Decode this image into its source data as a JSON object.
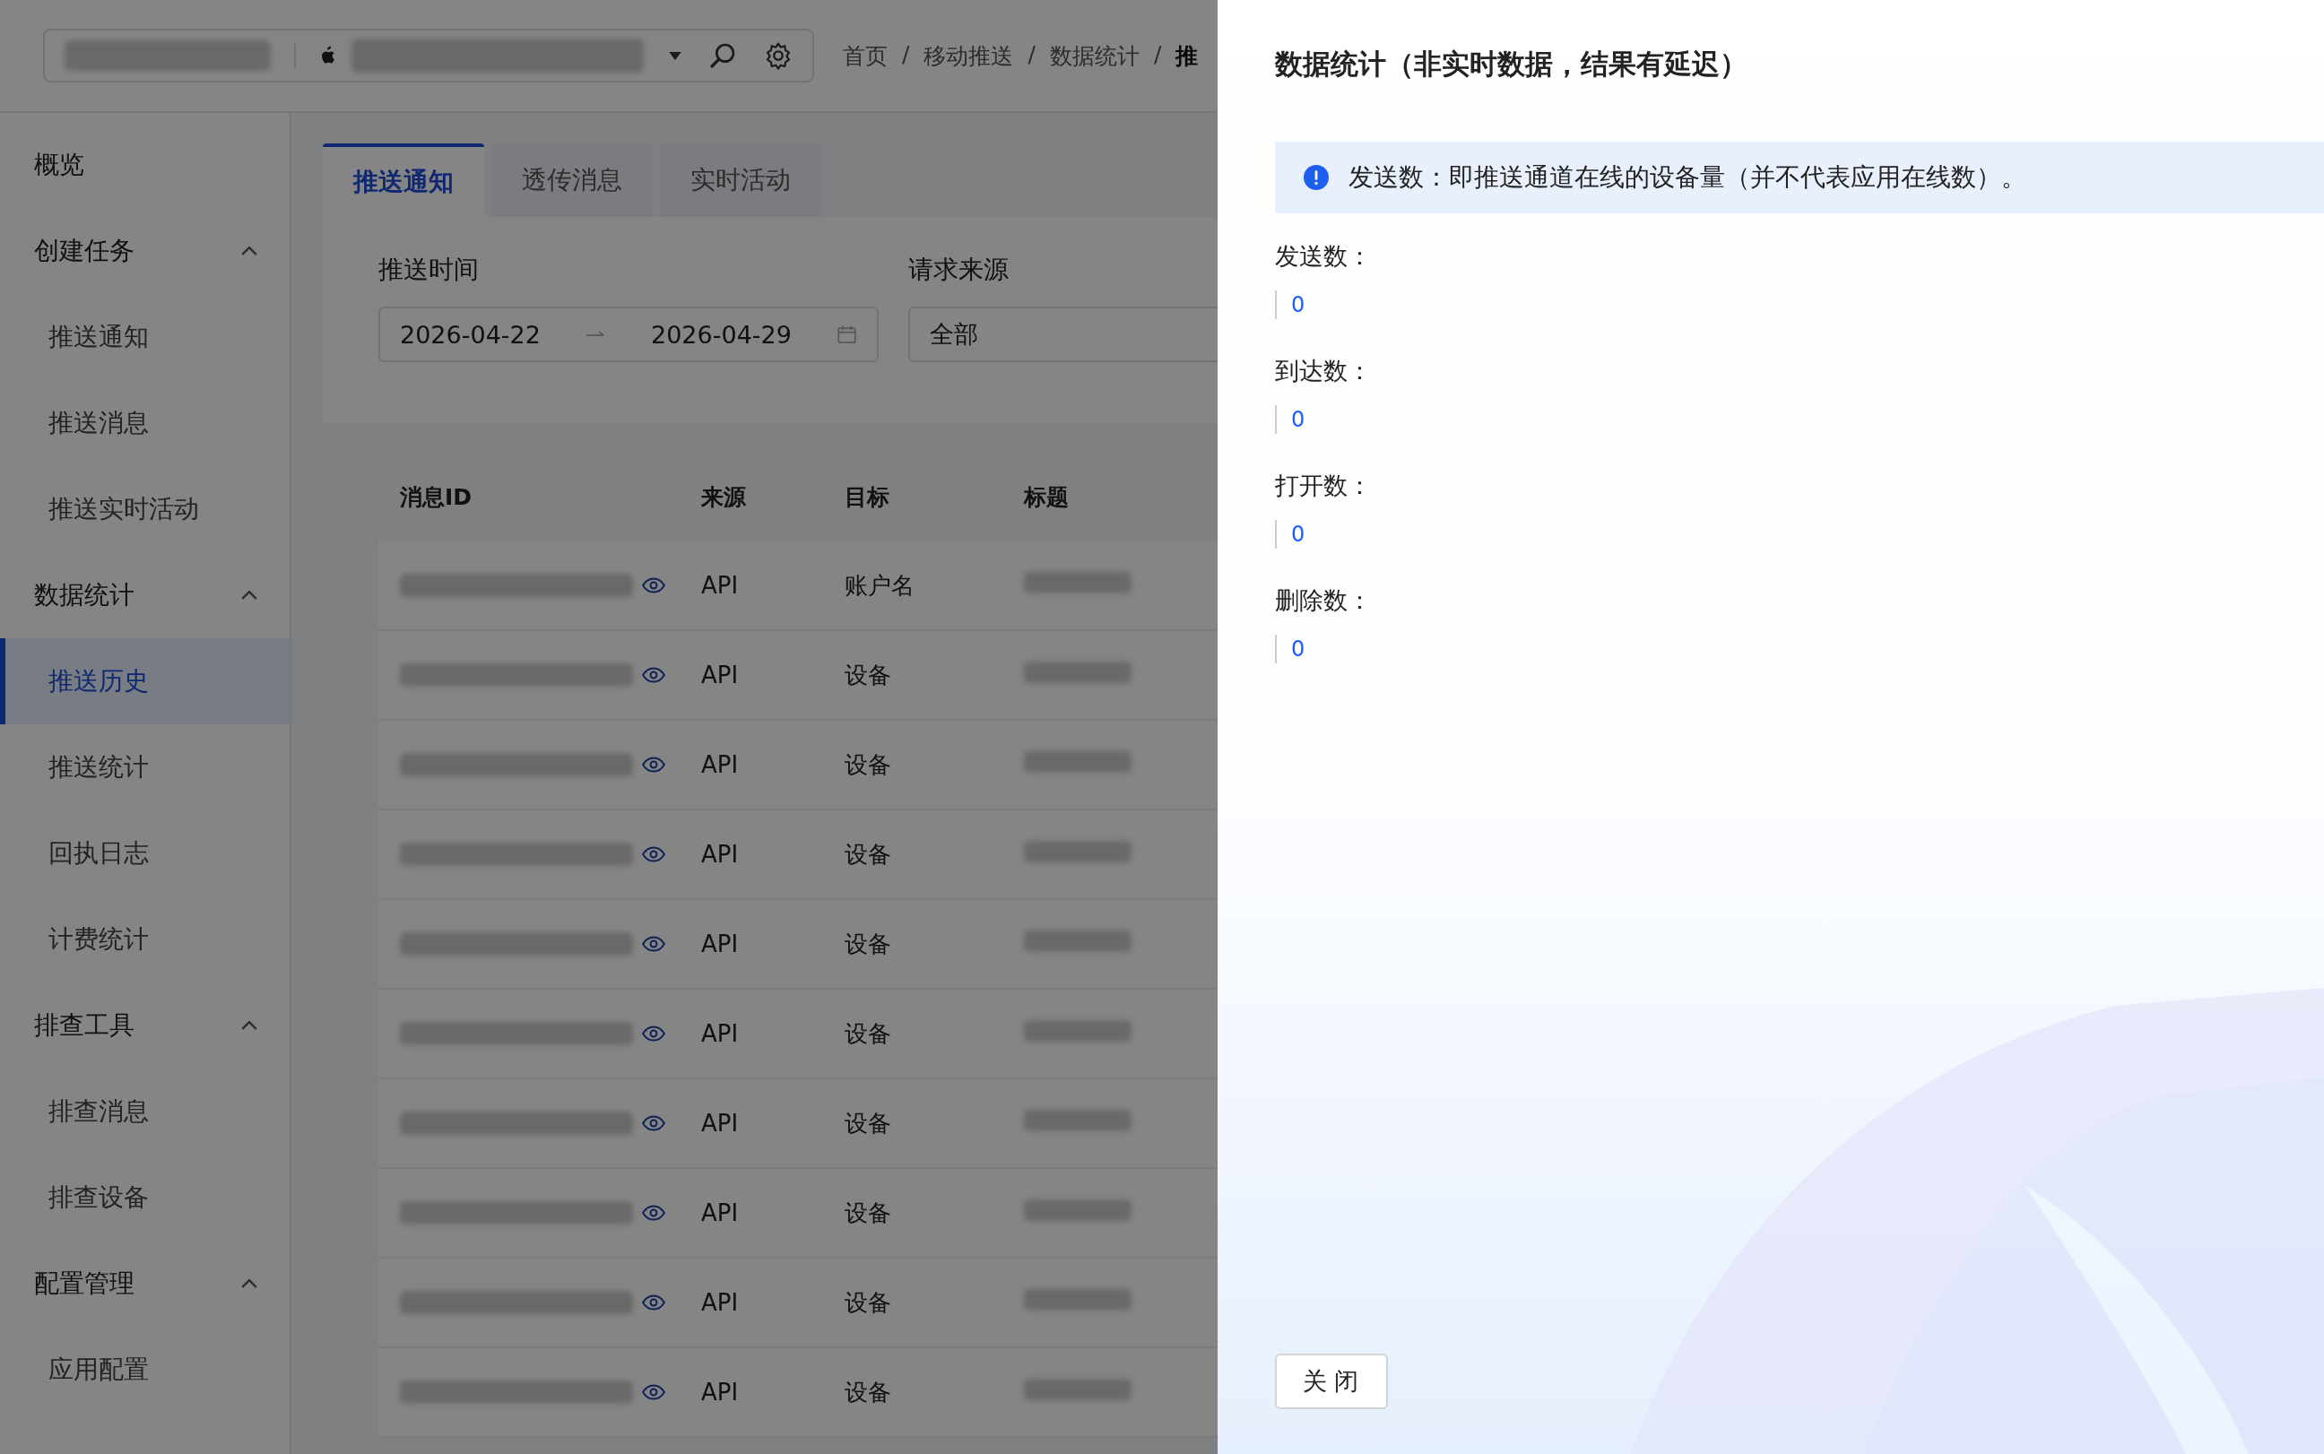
{
  "header": {
    "separator": "/",
    "breadcrumb": [
      "首页",
      "移动推送",
      "数据统计",
      "推"
    ]
  },
  "sidebar": {
    "items": [
      {
        "label": "概览",
        "kind": "link"
      },
      {
        "label": "创建任务",
        "kind": "group",
        "expanded": true,
        "children": [
          {
            "label": "推送通知",
            "selected": false
          },
          {
            "label": "推送消息",
            "selected": false
          },
          {
            "label": "推送实时活动",
            "selected": false
          }
        ]
      },
      {
        "label": "数据统计",
        "kind": "group",
        "expanded": true,
        "children": [
          {
            "label": "推送历史",
            "selected": true
          },
          {
            "label": "推送统计",
            "selected": false
          },
          {
            "label": "回执日志",
            "selected": false
          },
          {
            "label": "计费统计",
            "selected": false
          }
        ]
      },
      {
        "label": "排查工具",
        "kind": "group",
        "expanded": true,
        "children": [
          {
            "label": "排查消息",
            "selected": false
          },
          {
            "label": "排查设备",
            "selected": false
          }
        ]
      },
      {
        "label": "配置管理",
        "kind": "group",
        "expanded": true,
        "children": [
          {
            "label": "应用配置",
            "selected": false
          }
        ]
      }
    ]
  },
  "tabs": [
    {
      "label": "推送通知",
      "selected": true
    },
    {
      "label": "透传消息",
      "selected": false
    },
    {
      "label": "实时活动",
      "selected": false
    }
  ],
  "filters": [
    {
      "label": "推送时间",
      "kind": "date_range",
      "start": "2026-04-22",
      "end": "2026-04-29"
    },
    {
      "label": "请求来源",
      "kind": "select",
      "value": "全部"
    }
  ],
  "table": {
    "columns": [
      "消息ID",
      "来源",
      "目标",
      "标题"
    ],
    "rows": [
      {
        "source": "API",
        "target": "账户名"
      },
      {
        "source": "API",
        "target": "设备"
      },
      {
        "source": "API",
        "target": "设备"
      },
      {
        "source": "API",
        "target": "设备"
      },
      {
        "source": "API",
        "target": "设备"
      },
      {
        "source": "API",
        "target": "设备"
      },
      {
        "source": "API",
        "target": "设备"
      },
      {
        "source": "API",
        "target": "设备"
      },
      {
        "source": "API",
        "target": "设备"
      },
      {
        "source": "API",
        "target": "设备"
      }
    ]
  },
  "drawer": {
    "title": "数据统计（非实时数据，结果有延迟）",
    "alert": "发送数：即推送通道在线的设备量（并不代表应用在线数）。",
    "stats": [
      {
        "label": "发送数：",
        "value": "0"
      },
      {
        "label": "到达数：",
        "value": "0"
      },
      {
        "label": "打开数：",
        "value": "0"
      },
      {
        "label": "删除数：",
        "value": "0"
      }
    ],
    "close_button": "关闭"
  }
}
